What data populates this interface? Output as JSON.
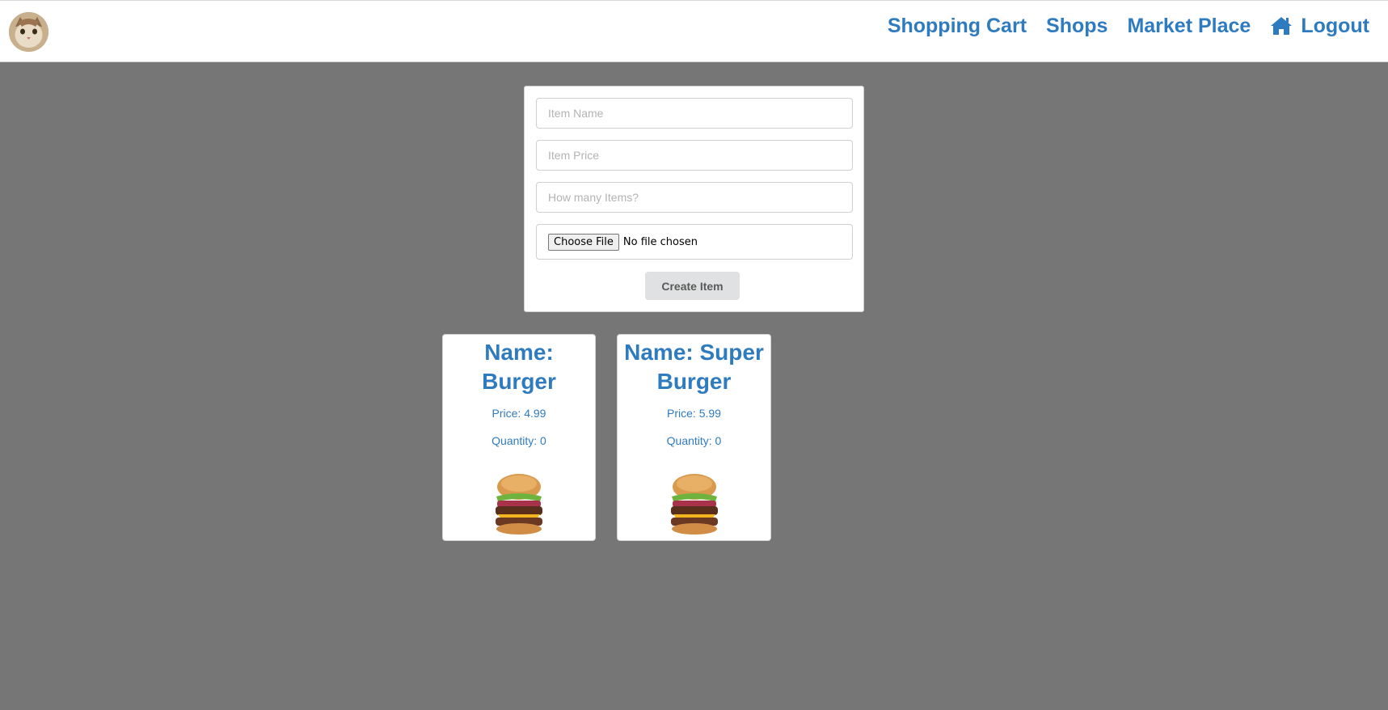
{
  "nav": {
    "links": [
      {
        "label": "Shopping Cart"
      },
      {
        "label": "Shops"
      },
      {
        "label": "Market Place"
      },
      {
        "label": "Logout"
      }
    ]
  },
  "form": {
    "item_name_placeholder": "Item Name",
    "item_price_placeholder": "Item Price",
    "quantity_placeholder": "How many Items?",
    "choose_file_label": "Choose File",
    "file_status": "No file chosen",
    "create_button_label": "Create Item"
  },
  "items": [
    {
      "name": "Name: Burger",
      "price": "Price: 4.99",
      "quantity": "Quantity: 0"
    },
    {
      "name": "Name: Super Burger",
      "price": "Price: 5.99",
      "quantity": "Quantity: 0"
    }
  ],
  "colors": {
    "accent": "#2f7bbf",
    "background": "#767676"
  }
}
